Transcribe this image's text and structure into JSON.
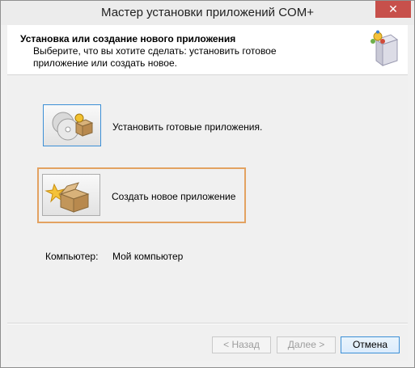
{
  "window": {
    "title": "Мастер установки приложений COM+",
    "close_glyph": "✕"
  },
  "header": {
    "title": "Установка или создание нового приложения",
    "subtitle": "Выберите, что вы хотите сделать: установить готовое приложение или создать новое.",
    "icon": "com-package-icon"
  },
  "options": [
    {
      "label": "Установить готовые приложения.",
      "icon": "cd-package-icon"
    },
    {
      "label": "Создать новое приложение",
      "icon": "new-box-icon"
    }
  ],
  "computer": {
    "label": "Компьютер:",
    "value": "Мой компьютер"
  },
  "buttons": {
    "back": "< Назад",
    "next": "Далее >",
    "cancel": "Отмена"
  },
  "colors": {
    "close_button": "#c7504b",
    "focus_border": "#3c8fd6",
    "highlight_border": "#e3a261"
  }
}
